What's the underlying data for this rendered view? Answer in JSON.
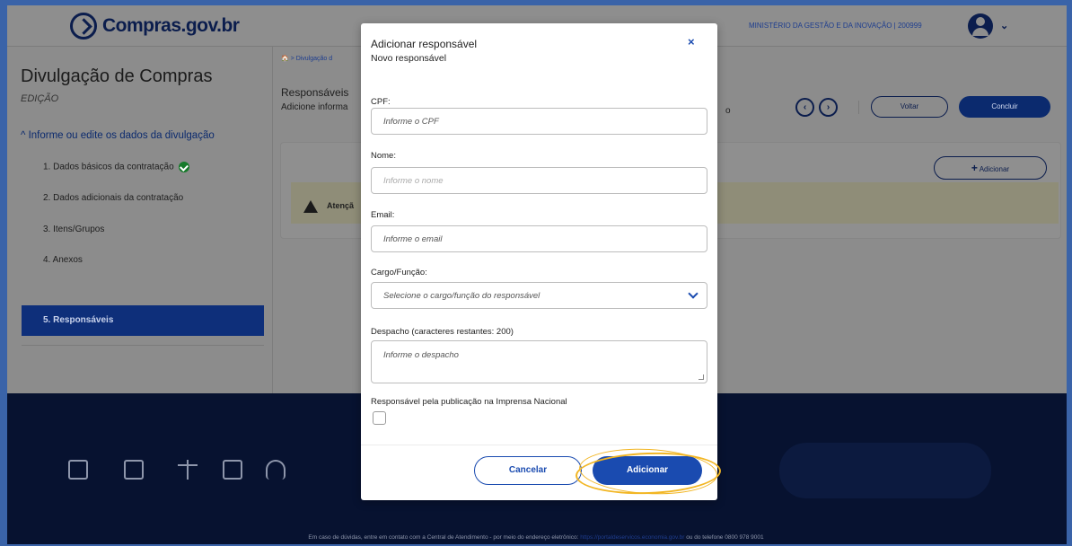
{
  "header": {
    "logo_text": "Compras.gov.br",
    "ministry": "MINISTÉRIO DA GESTÃO E DA INOVAÇÃO | 200999",
    "icons": [
      "compras-logo-icon",
      "user-avatar-icon",
      "chevron-down-icon"
    ]
  },
  "sidebar": {
    "title": "Divulgação de Compras",
    "mode": "EDIÇÃO",
    "section": "^ Informe ou edite os dados da divulgação",
    "items": [
      {
        "label": "1. Dados básicos da contratação",
        "done": true
      },
      {
        "label": "2. Dados adicionais da contratação"
      },
      {
        "label": "3. Itens/Grupos"
      },
      {
        "label": "4. Anexos"
      },
      {
        "label": "5. Responsáveis",
        "active": true
      }
    ]
  },
  "main": {
    "breadcrumb": "🏠 >  Divulgação d",
    "title": "Responsáveis",
    "subtitle": "Adicione informa",
    "subtitle_tail": "o",
    "prev_label": "‹",
    "next_label": "›",
    "voltar_label": "Voltar",
    "concluir_label": "Concluir",
    "add_label": "Adicionar",
    "add_plus": "+",
    "warning": "Atençã"
  },
  "modal": {
    "title": "Adicionar responsável",
    "subtitle": "Novo responsável",
    "close": "×",
    "fields": {
      "cpf_label": "CPF:",
      "cpf_placeholder": "Informe o CPF",
      "nome_label": "Nome:",
      "nome_placeholder": "Informe o nome",
      "email_label": "Email:",
      "email_placeholder": "Informe o email",
      "cargo_label": "Cargo/Função:",
      "cargo_placeholder": "Selecione o cargo/função do responsável",
      "despacho_label": "Despacho (caracteres restantes: 200)",
      "despacho_placeholder": "Informe o despacho",
      "imprensa_label": "Responsável pela publicação na Imprensa Nacional"
    },
    "cancel_label": "Cancelar",
    "submit_label": "Adicionar"
  },
  "footer": {
    "text": "Em caso de dúvidas, entre em contato com a Central de Atendimento - por meio do endereço eletrônico:",
    "link": "https://portaldeservicos.economia.gov.br",
    "text2": "ou do telefone 0800 978 9001",
    "icons": [
      "newspaper-icon",
      "video-icon",
      "scale-icon",
      "id-card-icon",
      "headset-icon"
    ]
  },
  "colors": {
    "primary": "#1a4bb0",
    "navy": "#0b1d4d",
    "highlight": "#f2b624",
    "success": "#167a2a"
  }
}
